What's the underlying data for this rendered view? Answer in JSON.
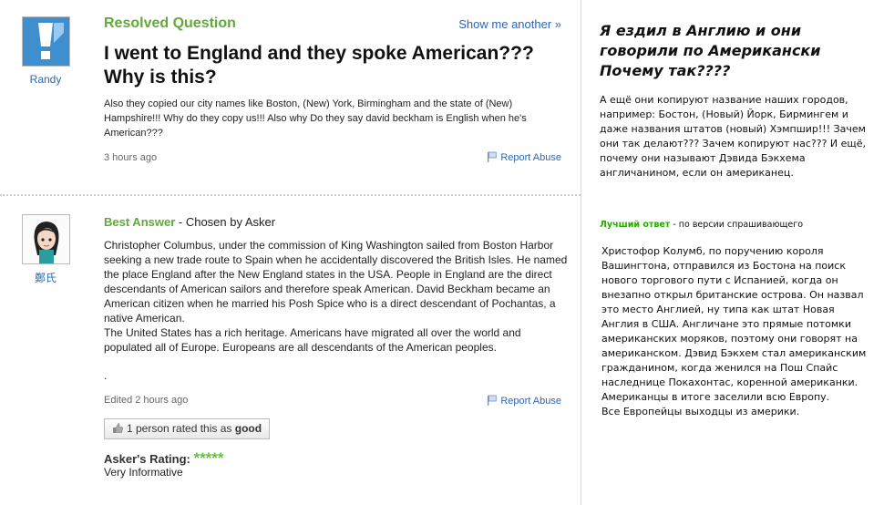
{
  "question": {
    "status_label": "Resolved Question",
    "show_another": "Show me another »",
    "asker_name": "Randy",
    "title": "I went to England and they spoke American??? Why is this?",
    "body": "Also they copied our city names like Boston, (New) York, Birmingham and the state of (New) Hampshire!!! Why do they copy us!!! Also why Do they say david beckham is English when he's American???",
    "time": "3 hours ago",
    "report_abuse": "Report Abuse"
  },
  "answer": {
    "answerer_name": "鄭氏",
    "best_label": "Best Answer",
    "chosen_by": " - Chosen by Asker",
    "body": "Christopher Columbus, under the commission of King Washington sailed from Boston Harbor seeking a new trade route to Spain when he accidentally discovered the British Isles. He named the place England after the New England states in the USA. People in England are the direct descendants of American sailors and therefore speak American. David Beckham became an American citizen when he married his Posh Spice who is a direct descendant of Pochantas, a native American.\nThe United States has a rich heritage. Americans have migrated all over the world and populated all of Europe. Europeans are all descendants of the American peoples.",
    "dot": ".",
    "edited": "Edited 2 hours ago",
    "report_abuse": "Report Abuse",
    "rated_prefix": "1 person rated this as ",
    "rated_value": "good",
    "asker_rating_label": "Asker's Rating: ",
    "stars": "*****",
    "rating_text": "Very Informative"
  },
  "translation": {
    "title": "Я ездил в Англию и они говорили по Американски\nПочему так????",
    "question": "А ещё они копируют название наших городов, например: Бостон, (Новый) Йорк, Бирмингем и даже названия штатов (новый) Хэмпшир!!! Зачем они так делают??? Зачем копируют нас??? И ещё, почему они называют Дэвида Бэкхема англичанином, если он американец.",
    "best_label": "Лучший ответ",
    "best_suffix": " - по версии спрашивающего",
    "answer": "Христофор Колумб, по поручению короля Вашингтона, отправился из Бостона на поиск нового торгового пути с Испанией, когда он внезапно открыл британские острова. Он назвал это место Англией, ну типа как штат Новая Англия в США. Англичане это прямые потомки американских моряков, поэтому они говорят на американском. Дэвид Бэкхем стал американским гражданином, когда женился на Пош Спайс наследнице Покахонтас, коренной американки.\nАмериканцы в итоге заселили всю Европу.\nВсе Европейцы выходцы из америки."
  }
}
